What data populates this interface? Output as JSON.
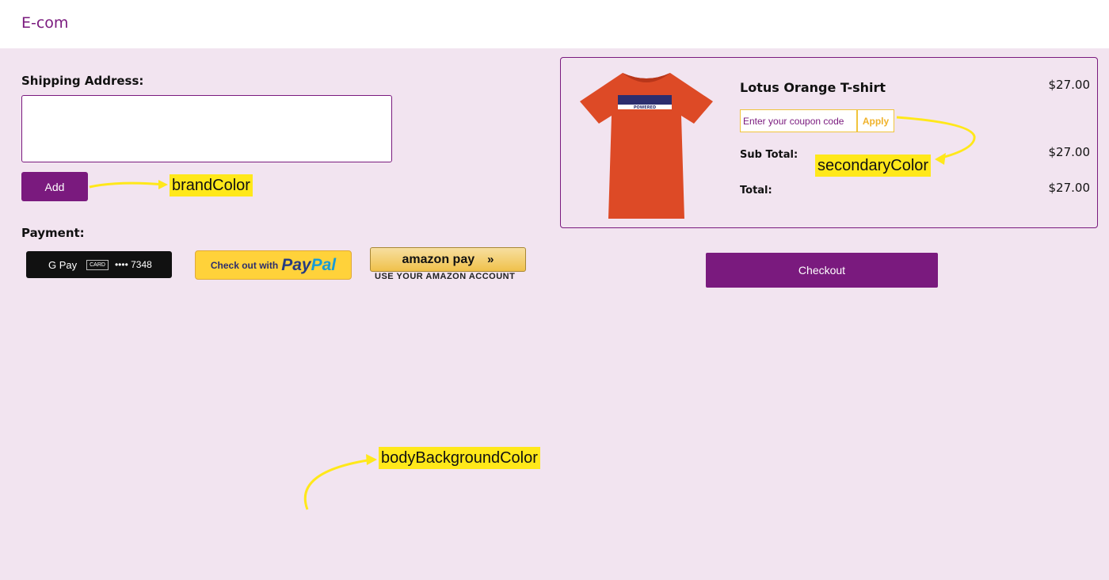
{
  "header": {
    "brand": "E-com"
  },
  "shipping": {
    "label": "Shipping Address:",
    "value": "",
    "add_label": "Add"
  },
  "payment": {
    "label": "Payment:",
    "gpay": {
      "brand": "G Pay",
      "card_label": "CARD",
      "card_number": "•••• 7348"
    },
    "paypal": {
      "prefix": "Check out with",
      "pay": "Pay",
      "pal": "Pal"
    },
    "amazon": {
      "label": "amazon pay",
      "chevron": "»",
      "sub": "USE YOUR AMAZON ACCOUNT"
    }
  },
  "cart": {
    "product_name": "Lotus Orange T-shirt",
    "product_price": "$27.00",
    "coupon_placeholder": "Enter your coupon code",
    "apply_label": "Apply",
    "subtotal_label": "Sub Total:",
    "subtotal_value": "$27.00",
    "total_label": "Total:",
    "total_value": "$27.00",
    "shirt_print": "POWERED"
  },
  "checkout_label": "Checkout",
  "annotations": {
    "brand": "brandColor",
    "secondary": "secondaryColor",
    "body": "bodyBackgroundColor"
  },
  "colors": {
    "brand": "#7a1a7e",
    "secondary": "#f0c43c",
    "body_background": "#f2e4f0",
    "annotation": "#ffe81a",
    "shirt": "#dd4a26"
  },
  "icons": {
    "product": "tshirt-icon",
    "annotation_arrow": "arrow-icon"
  }
}
